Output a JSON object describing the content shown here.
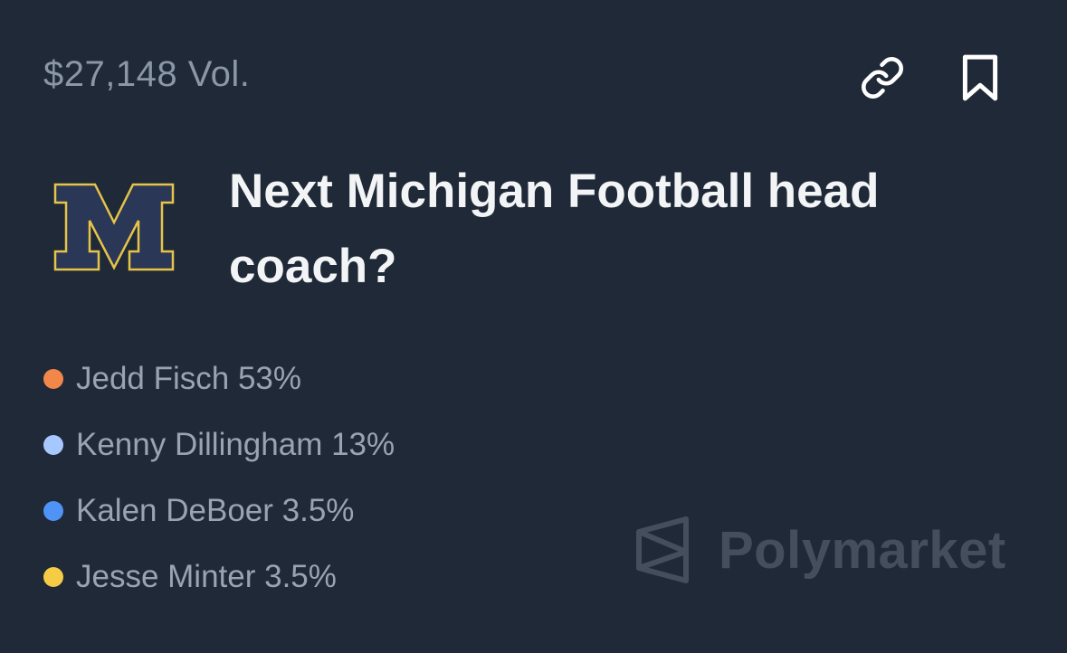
{
  "header": {
    "volume": "$27,148 Vol."
  },
  "market": {
    "logo": "michigan-block-m-logo",
    "title": "Next Michigan Football head coach?"
  },
  "outcomes": [
    {
      "name": "Jedd Fisch",
      "percent": "53%",
      "label": "Jedd Fisch 53%",
      "color": "#f2874a"
    },
    {
      "name": "Kenny Dillingham",
      "percent": "13%",
      "label": "Kenny Dillingham 13%",
      "color": "#a6c8ff"
    },
    {
      "name": "Kalen DeBoer",
      "percent": "3.5%",
      "label": "Kalen DeBoer 3.5%",
      "color": "#4f93f6"
    },
    {
      "name": "Jesse Minter",
      "percent": "3.5%",
      "label": "Jesse Minter 3.5%",
      "color": "#f5cc45"
    }
  ],
  "icons": {
    "copy_link": "link-icon",
    "bookmark": "bookmark-icon",
    "brand": "polymarket-logo-icon"
  },
  "watermark": {
    "text": "Polymarket"
  },
  "colors": {
    "background": "#1f2937",
    "michigan_navy": "#2a3756",
    "michigan_maize": "#e6c449"
  }
}
